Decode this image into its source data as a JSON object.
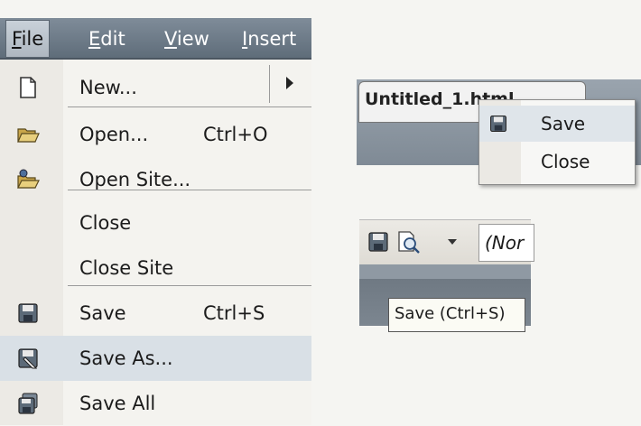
{
  "menubar": {
    "items": [
      "File",
      "Edit",
      "View",
      "Insert"
    ]
  },
  "file_menu": {
    "items": [
      {
        "label": "New...",
        "shortcut": "",
        "icon": "new-document-icon",
        "has_submenu": true
      },
      {
        "label": "Open...",
        "shortcut": "Ctrl+O",
        "icon": "open-folder-icon"
      },
      {
        "label": "Open Site...",
        "shortcut": "",
        "icon": "open-site-icon"
      },
      {
        "label": "Close",
        "shortcut": ""
      },
      {
        "label": "Close Site",
        "shortcut": ""
      },
      {
        "label": "Save",
        "shortcut": "Ctrl+S",
        "icon": "save-icon"
      },
      {
        "label": "Save As...",
        "shortcut": "",
        "icon": "save-as-icon",
        "highlighted": true
      },
      {
        "label": "Save All",
        "shortcut": "",
        "icon": "save-all-icon"
      }
    ]
  },
  "document_tab": {
    "title": "Untitled_1.html"
  },
  "context_menu": {
    "items": [
      {
        "label": "Save",
        "icon": "save-icon"
      },
      {
        "label": "Close"
      }
    ]
  },
  "toolbar": {
    "combo_value": "(Nor",
    "tooltip": "Save (Ctrl+S)"
  },
  "colors": {
    "menubar": "#6f7c89",
    "highlight": "#d9e0e6",
    "menu_bg": "#f4f3ef"
  }
}
